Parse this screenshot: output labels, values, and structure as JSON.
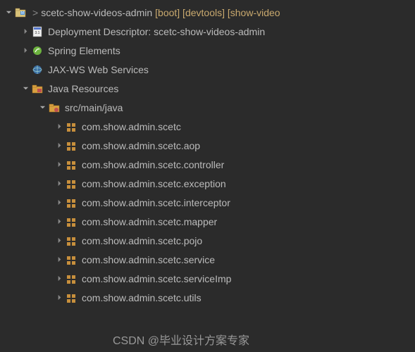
{
  "project": {
    "prefix": ">",
    "name": "scetc-show-videos-admin",
    "decorators": "[boot] [devtools] [show-video"
  },
  "nodes": [
    {
      "label": "Deployment Descriptor: scetc-show-videos-admin",
      "icon": "deploy-descriptor",
      "indent": 1,
      "expanded": false,
      "arrow": true
    },
    {
      "label": "Spring Elements",
      "icon": "spring",
      "indent": 1,
      "expanded": false,
      "arrow": true
    },
    {
      "label": "JAX-WS Web Services",
      "icon": "jaxws",
      "indent": 1,
      "expanded": false,
      "arrow": false
    },
    {
      "label": "Java Resources",
      "icon": "java-resources",
      "indent": 1,
      "expanded": true,
      "arrow": true
    },
    {
      "label": "src/main/java",
      "icon": "src-folder",
      "indent": 2,
      "expanded": true,
      "arrow": true
    },
    {
      "label": "com.show.admin.scetc",
      "icon": "package",
      "indent": 3,
      "expanded": false,
      "arrow": true
    },
    {
      "label": "com.show.admin.scetc.aop",
      "icon": "package",
      "indent": 3,
      "expanded": false,
      "arrow": true
    },
    {
      "label": "com.show.admin.scetc.controller",
      "icon": "package",
      "indent": 3,
      "expanded": false,
      "arrow": true
    },
    {
      "label": "com.show.admin.scetc.exception",
      "icon": "package",
      "indent": 3,
      "expanded": false,
      "arrow": true
    },
    {
      "label": "com.show.admin.scetc.interceptor",
      "icon": "package",
      "indent": 3,
      "expanded": false,
      "arrow": true
    },
    {
      "label": "com.show.admin.scetc.mapper",
      "icon": "package",
      "indent": 3,
      "expanded": false,
      "arrow": true
    },
    {
      "label": "com.show.admin.scetc.pojo",
      "icon": "package",
      "indent": 3,
      "expanded": false,
      "arrow": true
    },
    {
      "label": "com.show.admin.scetc.service",
      "icon": "package",
      "indent": 3,
      "expanded": false,
      "arrow": true
    },
    {
      "label": "com.show.admin.scetc.serviceImp",
      "icon": "package",
      "indent": 3,
      "expanded": false,
      "arrow": true
    },
    {
      "label": "com.show.admin.scetc.utils",
      "icon": "package",
      "indent": 3,
      "expanded": false,
      "arrow": true
    }
  ],
  "watermark": "CSDN @毕业设计方案专家"
}
